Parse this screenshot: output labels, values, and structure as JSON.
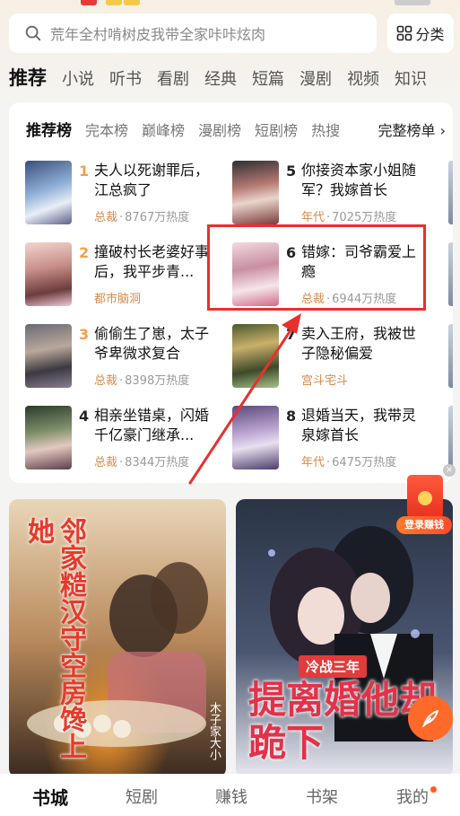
{
  "search": {
    "placeholder": "荒年全村啃树皮我带全家咔咔炫肉"
  },
  "category_button": {
    "label": "分类"
  },
  "top_tabs": [
    {
      "label": "推荐",
      "active": true
    },
    {
      "label": "小说"
    },
    {
      "label": "听书"
    },
    {
      "label": "看剧"
    },
    {
      "label": "经典"
    },
    {
      "label": "短篇"
    },
    {
      "label": "漫剧"
    },
    {
      "label": "视频"
    },
    {
      "label": "知识"
    }
  ],
  "ranking": {
    "tabs": [
      "推荐榜",
      "完本榜",
      "巅峰榜",
      "漫剧榜",
      "短剧榜",
      "热搜"
    ],
    "full_list_label": "完整榜单 ›",
    "books": [
      {
        "rank": "1",
        "title": "夫人以死谢罪后，江总疯了",
        "tag": "总裁",
        "heat": "8767万热度"
      },
      {
        "rank": "2",
        "title": "撞破村长老婆好事后，我平步青...",
        "tag": "都市脑洞",
        "heat": ""
      },
      {
        "rank": "3",
        "title": "偷偷生了崽，太子爷卑微求复合",
        "tag": "总裁",
        "heat": "8398万热度"
      },
      {
        "rank": "4",
        "title": "相亲坐错桌，闪婚千亿豪门继承...",
        "tag": "总裁",
        "heat": "8344万热度"
      },
      {
        "rank": "5",
        "title": "你接资本家小姐随军？我嫁首长",
        "tag": "年代",
        "heat": "7025万热度"
      },
      {
        "rank": "6",
        "title": "错嫁：司爷霸爱上瘾",
        "tag": "总裁",
        "heat": "6944万热度"
      },
      {
        "rank": "7",
        "title": "卖入王府，我被世子隐秘偏爱",
        "tag": "宫斗宅斗",
        "heat": ""
      },
      {
        "rank": "8",
        "title": "退婚当天，我带灵泉嫁首长",
        "tag": "年代",
        "heat": "6475万热度"
      }
    ],
    "dot": "·"
  },
  "banners": {
    "left_title": "邻家糙汉守空房馋上她",
    "left_author": "木子家大小",
    "right_subtitle": "冷战三年",
    "right_title": "提离婚他却跪下"
  },
  "redpacket": {
    "label": "登录赚钱",
    "close": "×"
  },
  "bottom_nav": [
    {
      "label": "书城",
      "active": true
    },
    {
      "label": "短剧"
    },
    {
      "label": "赚钱"
    },
    {
      "label": "书架"
    },
    {
      "label": "我的"
    }
  ],
  "colors": {
    "accent": "#d8894a",
    "highlight": "#e8302e",
    "fab": "#ff6a2a"
  }
}
